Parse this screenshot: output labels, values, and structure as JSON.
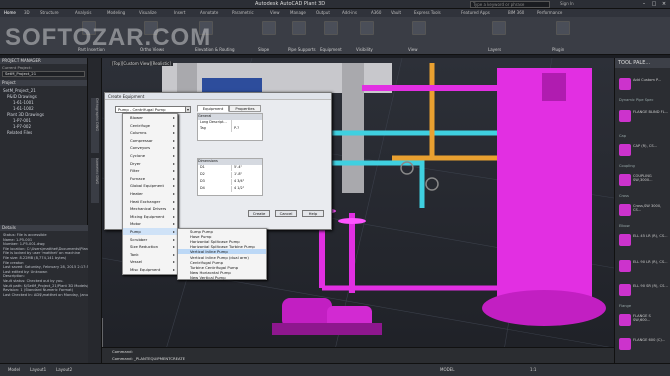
{
  "window": {
    "title": "Autodesk AutoCAD Plant 3D",
    "search_placeholder": "Type a keyword or phrase",
    "user": "Sign In"
  },
  "ribbon_tabs": [
    "Home",
    "3D",
    "Structure",
    "Analysis",
    "Modeling",
    "Visualize",
    "Insert",
    "Annotate",
    "Parametric",
    "View",
    "Manage",
    "Output",
    "Add-ins",
    "A360",
    "Vault",
    "Express Tools",
    "Featured Apps",
    "BIM 360",
    "Performance"
  ],
  "ribbon_panels": [
    "Part Insertion",
    "Ortho Views",
    "Elevation & Routing",
    "Slope",
    "Pipe Supports",
    "Equipment",
    "Visibility",
    "View",
    "Layers",
    "Plugin"
  ],
  "watermark": "SOFTOZAR.COM",
  "project_manager": {
    "title": "PROJECT MANAGER",
    "current_project_label": "Current Project:",
    "current_project": "SetM_Project_21",
    "project_header": "Project",
    "tree": [
      "SetM_Project_21",
      "P&ID Drawings",
      "1-61-1001",
      "1-61-1002",
      "Plant 3D Drawings",
      "1-P7-001",
      "1-P7-002",
      "Related Files"
    ]
  },
  "details": {
    "title": "Details",
    "lines": [
      "Status: File is accessible",
      "Name: 1-P5-001",
      "Number: 1-P5-001.dwg",
      "File location: C:\\Users\\matthet\\Documents\\Plant",
      "File is locked by user 'matthet' on machine",
      "File size: 8.22MB (8,774,141 bytes)",
      "File creator:",
      "Last saved: Saturday, February 28, 2015 2:17:52 PM",
      "Last edited by: Unknown",
      "Description:",
      "",
      "Vault status: Checked out by you.",
      "Vault path: $/SetM_Project_21/Plant 3D Models/1-",
      "Revision: 1 (Standard Numeric Format)",
      "Last Checked In: AD$\\matthet on Monday, January"
    ]
  },
  "side_tabs": [
    "Orthographic DWG",
    "Isometric DWG"
  ],
  "viewport_label": "[Top][Custom View][Realistic]",
  "dialog": {
    "title": "Create Equipment",
    "combo_value": "Pump - Centrifugal Pump",
    "tabs": [
      "Equipment",
      "Properties"
    ],
    "general_header": "General",
    "general_rows": [
      {
        "k": "Long Descript...",
        "v": ""
      },
      {
        "k": "Tag",
        "v": "P-?"
      }
    ],
    "dim_header": "Dimensions",
    "dim_rows": [
      {
        "k": "D1",
        "v": "5'-4\""
      },
      {
        "k": "D2",
        "v": "1'-8\""
      },
      {
        "k": "D3",
        "v": "4 3/4\""
      },
      {
        "k": "D4",
        "v": "4 1/2\""
      }
    ],
    "buttons": [
      "Create",
      "Cancel",
      "Help"
    ]
  },
  "menu1": [
    "Blower",
    "Centrifuge",
    "Columns",
    "Compressor",
    "Conveyors",
    "Cyclone",
    "Dryer",
    "Filter",
    "Furnace",
    "Global Equipment",
    "Heater",
    "Heat Exchanger",
    "Mechanical Drivers",
    "Mixing Equipment",
    "Motor",
    "Pump",
    "Scrubber",
    "Size Reduction",
    "Tank",
    "Vessel",
    "Misc Equipment"
  ],
  "menu1_selected": "Pump",
  "menu2": [
    "Sump Pump",
    "Hose Pump",
    "Horizontal Splitcase Pump",
    "Horizontal Splitcase Turbine Pump",
    "Vertical Inline Pump",
    "Vertical Inline Pump (dual arm)",
    "Centrifugal Pump",
    "Turbine Centrifugal Pump",
    "New Horizontal Pump",
    "New Vertical Pump"
  ],
  "menu2_selected": "Vertical Inline Pump",
  "tool_palette": {
    "title": "TOOL PALE...",
    "categories": [
      "Dynamic Pipe Spec",
      "Cap",
      "Coupling",
      "Cross",
      "Elbow",
      "Flange"
    ],
    "items": [
      {
        "label": "Add Custom P..."
      },
      {
        "label": "FLANGE BLIND FL..."
      },
      {
        "label": "CAP (R), CS..."
      },
      {
        "label": "COUPLING SW,3000..."
      },
      {
        "label": "Cross,SW 3000, CS..."
      },
      {
        "label": "ELL 45 LR (R), CS..."
      },
      {
        "label": "ELL 90 LR (R), CS..."
      },
      {
        "label": "ELL 90 SR (R), CS..."
      },
      {
        "label": "FLANGE S SW,600..."
      },
      {
        "label": "FLANGE 600 (C)..."
      }
    ]
  },
  "command": {
    "line1": "Command:",
    "line2": "Command: _PLANTEQUIPMENTCREATE"
  },
  "status": {
    "model": "MODEL",
    "scale": "1:1",
    "items": [
      "Model",
      "Layout1",
      "Layout2"
    ]
  }
}
